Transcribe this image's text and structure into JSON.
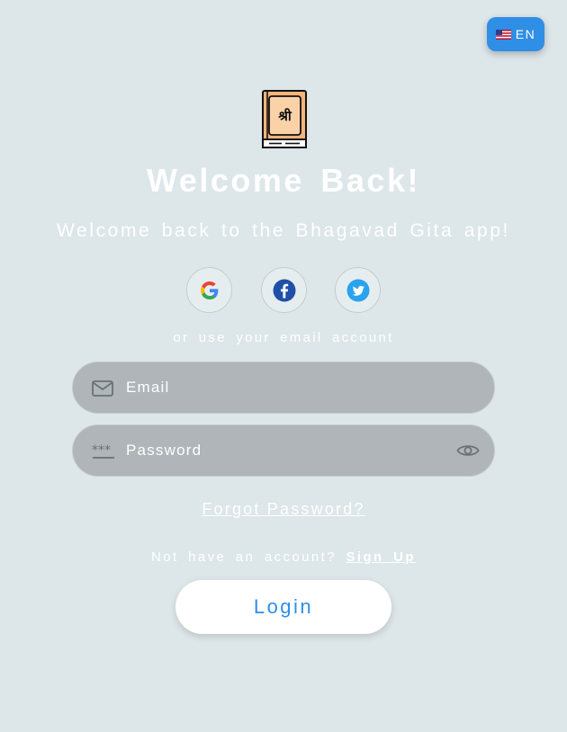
{
  "language": {
    "code": "EN",
    "flag": "us-flag-icon"
  },
  "header": {
    "logo": "shri-book-icon",
    "logo_glyph": "श्री",
    "title": "Welcome Back!",
    "subtitle": "Welcome back to the Bhagavad Gita app!"
  },
  "social": [
    {
      "name": "Google",
      "icon": "google-icon"
    },
    {
      "name": "Facebook",
      "icon": "facebook-icon"
    },
    {
      "name": "Twitter",
      "icon": "twitter-icon"
    }
  ],
  "divider_text": "or use your email account",
  "form": {
    "email": {
      "placeholder": "Email",
      "value": "",
      "icon": "mail-icon"
    },
    "password": {
      "placeholder": "Password",
      "value": "",
      "icon": "password-icon",
      "toggle_icon": "eye-icon"
    },
    "forgot_label": "Forgot Password?",
    "no_account_text": "Not have an account?",
    "signup_label": "Sign Up",
    "login_label": "Login"
  },
  "colors": {
    "background": "#dde6e9",
    "accent": "#2f8ee6",
    "field_bg": "#afb5b8",
    "logo_fill": "#f9b47c"
  }
}
